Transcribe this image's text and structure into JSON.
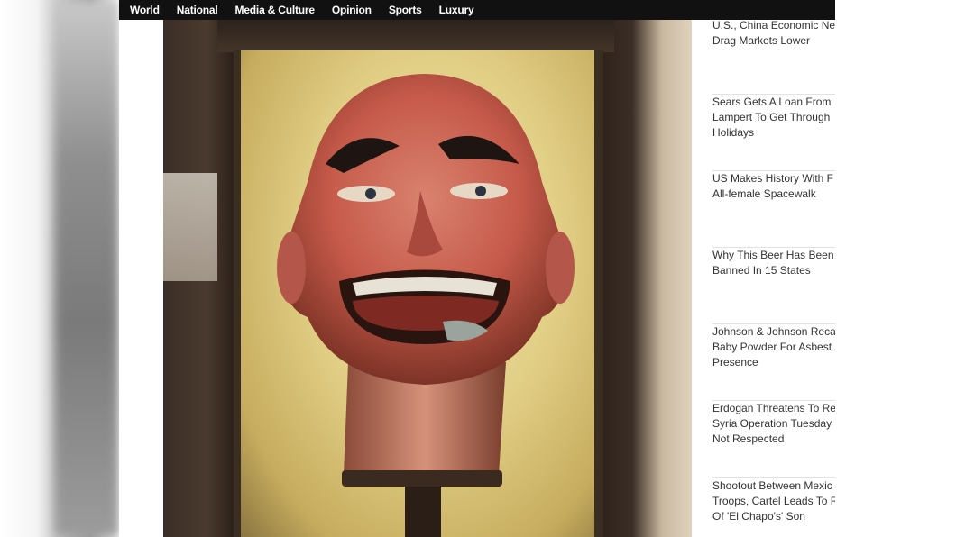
{
  "nav": {
    "items": [
      {
        "label": "World"
      },
      {
        "label": "National"
      },
      {
        "label": "Media & Culture"
      },
      {
        "label": "Opinion"
      },
      {
        "label": "Sports"
      },
      {
        "label": "Luxury"
      }
    ]
  },
  "photo": {
    "subject": "ventriloquist-dummy-head",
    "colors": {
      "face": "#c85a4e",
      "glass": "#e2cf86",
      "cabinet": "#3a2d22"
    }
  },
  "sidebar": {
    "items": [
      {
        "title": "U.S., China Economic New\nDrag Markets Lower"
      },
      {
        "title": "Sears Gets A Loan From\nLampert To Get Through\nHolidays"
      },
      {
        "title": "US Makes History With F\nAll-female Spacewalk"
      },
      {
        "title": "Why This Beer Has Been\nBanned In 15 States"
      },
      {
        "title": "Johnson & Johnson Reca\nBaby Powder For Asbest\nPresence"
      },
      {
        "title": "Erdogan Threatens To Re\nSyria Operation Tuesday\nNot Respected"
      },
      {
        "title": "Shootout Between Mexic\nTroops, Cartel Leads To R\nOf 'El Chapo's' Son"
      }
    ]
  }
}
